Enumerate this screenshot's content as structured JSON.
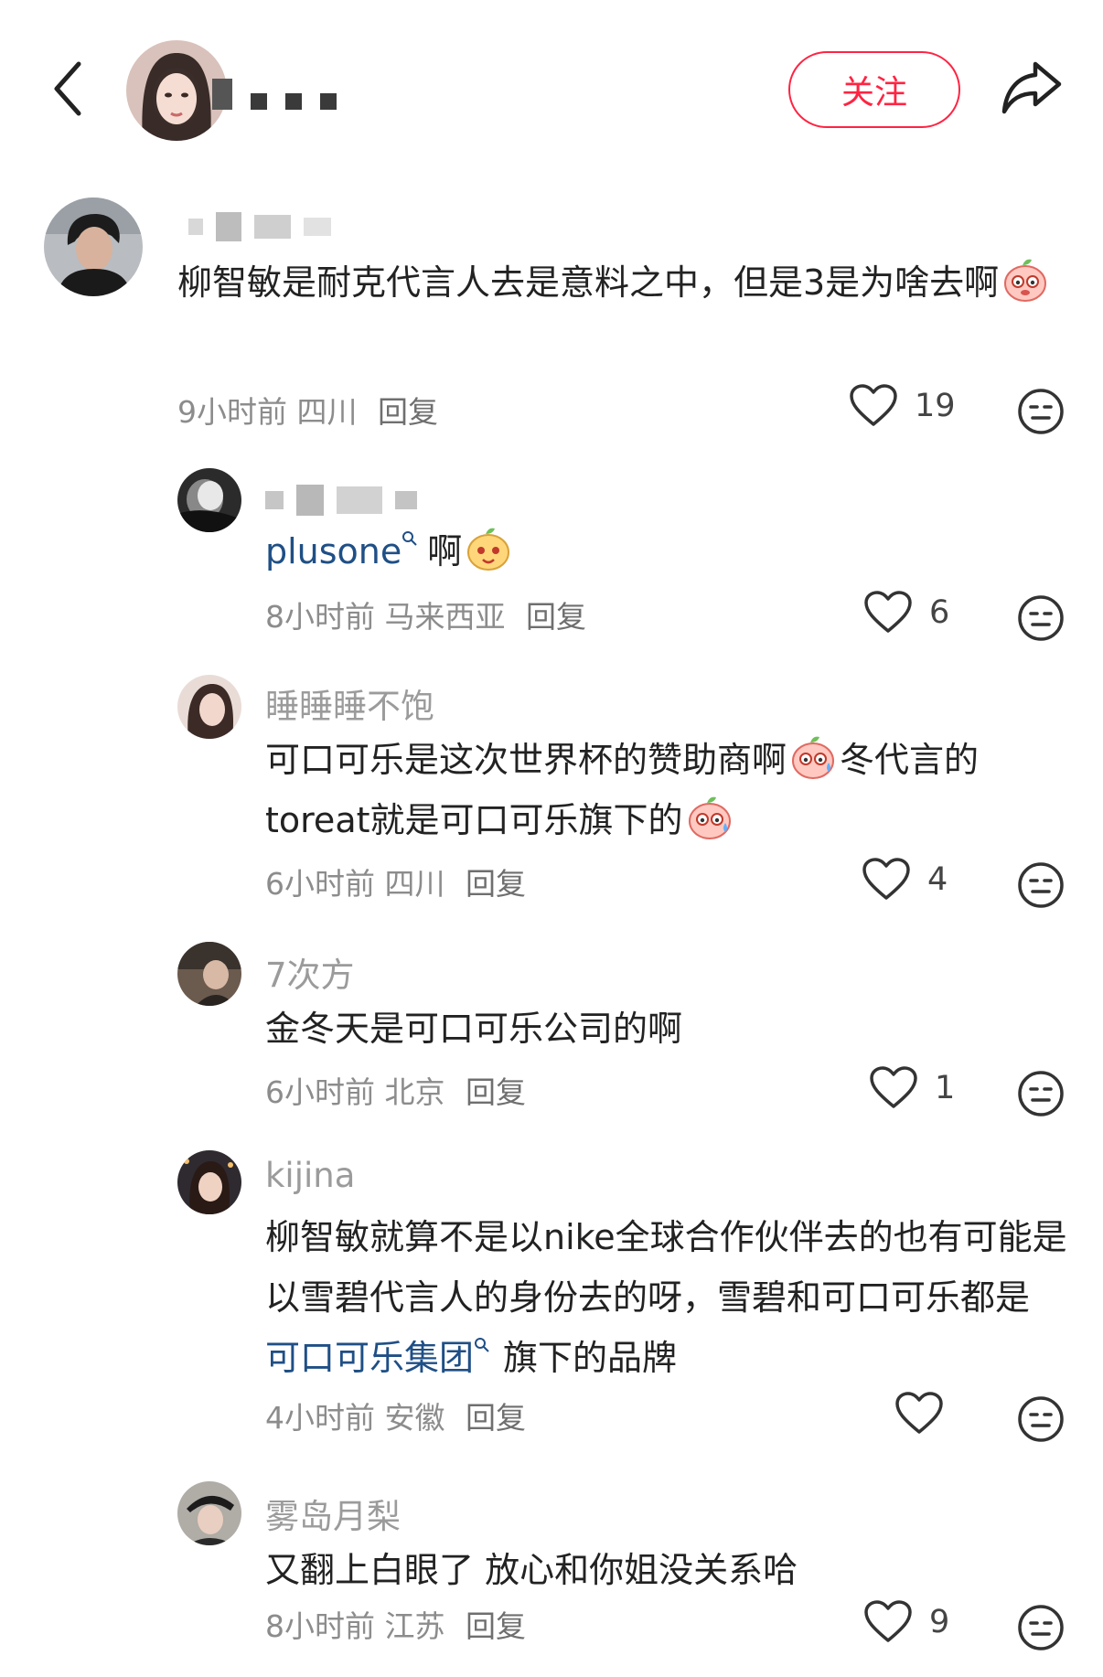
{
  "header": {
    "follow_label": "关注"
  },
  "comments": [
    {
      "text": "柳智敏是耐克代言人去是意料之中，但是3是为啥去啊",
      "time": "9小时前",
      "location": "四川",
      "reply": "回复",
      "likes": "19"
    },
    {
      "mention": "plusone",
      "text": "啊",
      "time": "8小时前",
      "location": "马来西亚",
      "reply": "回复",
      "likes": "6"
    },
    {
      "username": "睡睡睡不饱",
      "text_a": "可口可乐是这次世界杯的赞助商啊",
      "text_b": "冬代言的",
      "text_c": "toreat就是可口可乐旗下的",
      "time": "6小时前",
      "location": "四川",
      "reply": "回复",
      "likes": "4"
    },
    {
      "username": "7次方",
      "text": "金冬天是可口可乐公司的啊",
      "time": "6小时前",
      "location": "北京",
      "reply": "回复",
      "likes": "1"
    },
    {
      "username": "kijina",
      "text_a": "柳智敏就算不是以nike全球合作伙伴去的也有可能是以雪碧代言人的身份去的呀，雪碧和可口可乐都是",
      "link": "可口可乐集团",
      "text_b": "旗下的品牌",
      "time": "4小时前",
      "location": "安徽",
      "reply": "回复",
      "likes": ""
    },
    {
      "username": "雾岛月梨",
      "text": "又翻上白眼了 放心和你姐没关系哈",
      "time": "8小时前",
      "location": "江苏",
      "reply": "回复",
      "likes": "9"
    }
  ],
  "icons": {
    "back": "chevron-left-icon",
    "share": "share-arrow-icon",
    "like": "heart-outline-icon",
    "emoji": "neutral-face-icon",
    "search_link": "search-small-icon",
    "emoji_inline": "peach-face-sticker"
  },
  "colors": {
    "accent": "#ff2442",
    "link": "#1f4f86",
    "meta": "#8c8c8c",
    "username": "#9b9b9b"
  }
}
